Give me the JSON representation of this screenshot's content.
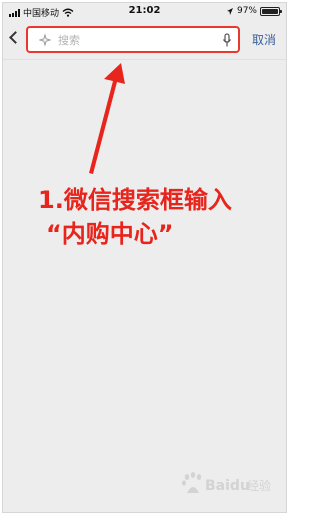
{
  "status_bar": {
    "carrier": "中国移动",
    "time": "21:02",
    "battery_text": "97%",
    "battery_level": 0.97
  },
  "search": {
    "placeholder": "搜索",
    "cancel_label": "取消",
    "highlight_color": "#e8392f"
  },
  "annotation": {
    "line1": "1.微信搜索框输入",
    "line2": "“内购中心”",
    "color": "#e8251c"
  },
  "watermark": {
    "brand": "Baidu经验"
  },
  "icons": [
    "back-icon",
    "search-icon",
    "mic-icon",
    "wifi-icon",
    "battery-icon",
    "signal-icon"
  ]
}
